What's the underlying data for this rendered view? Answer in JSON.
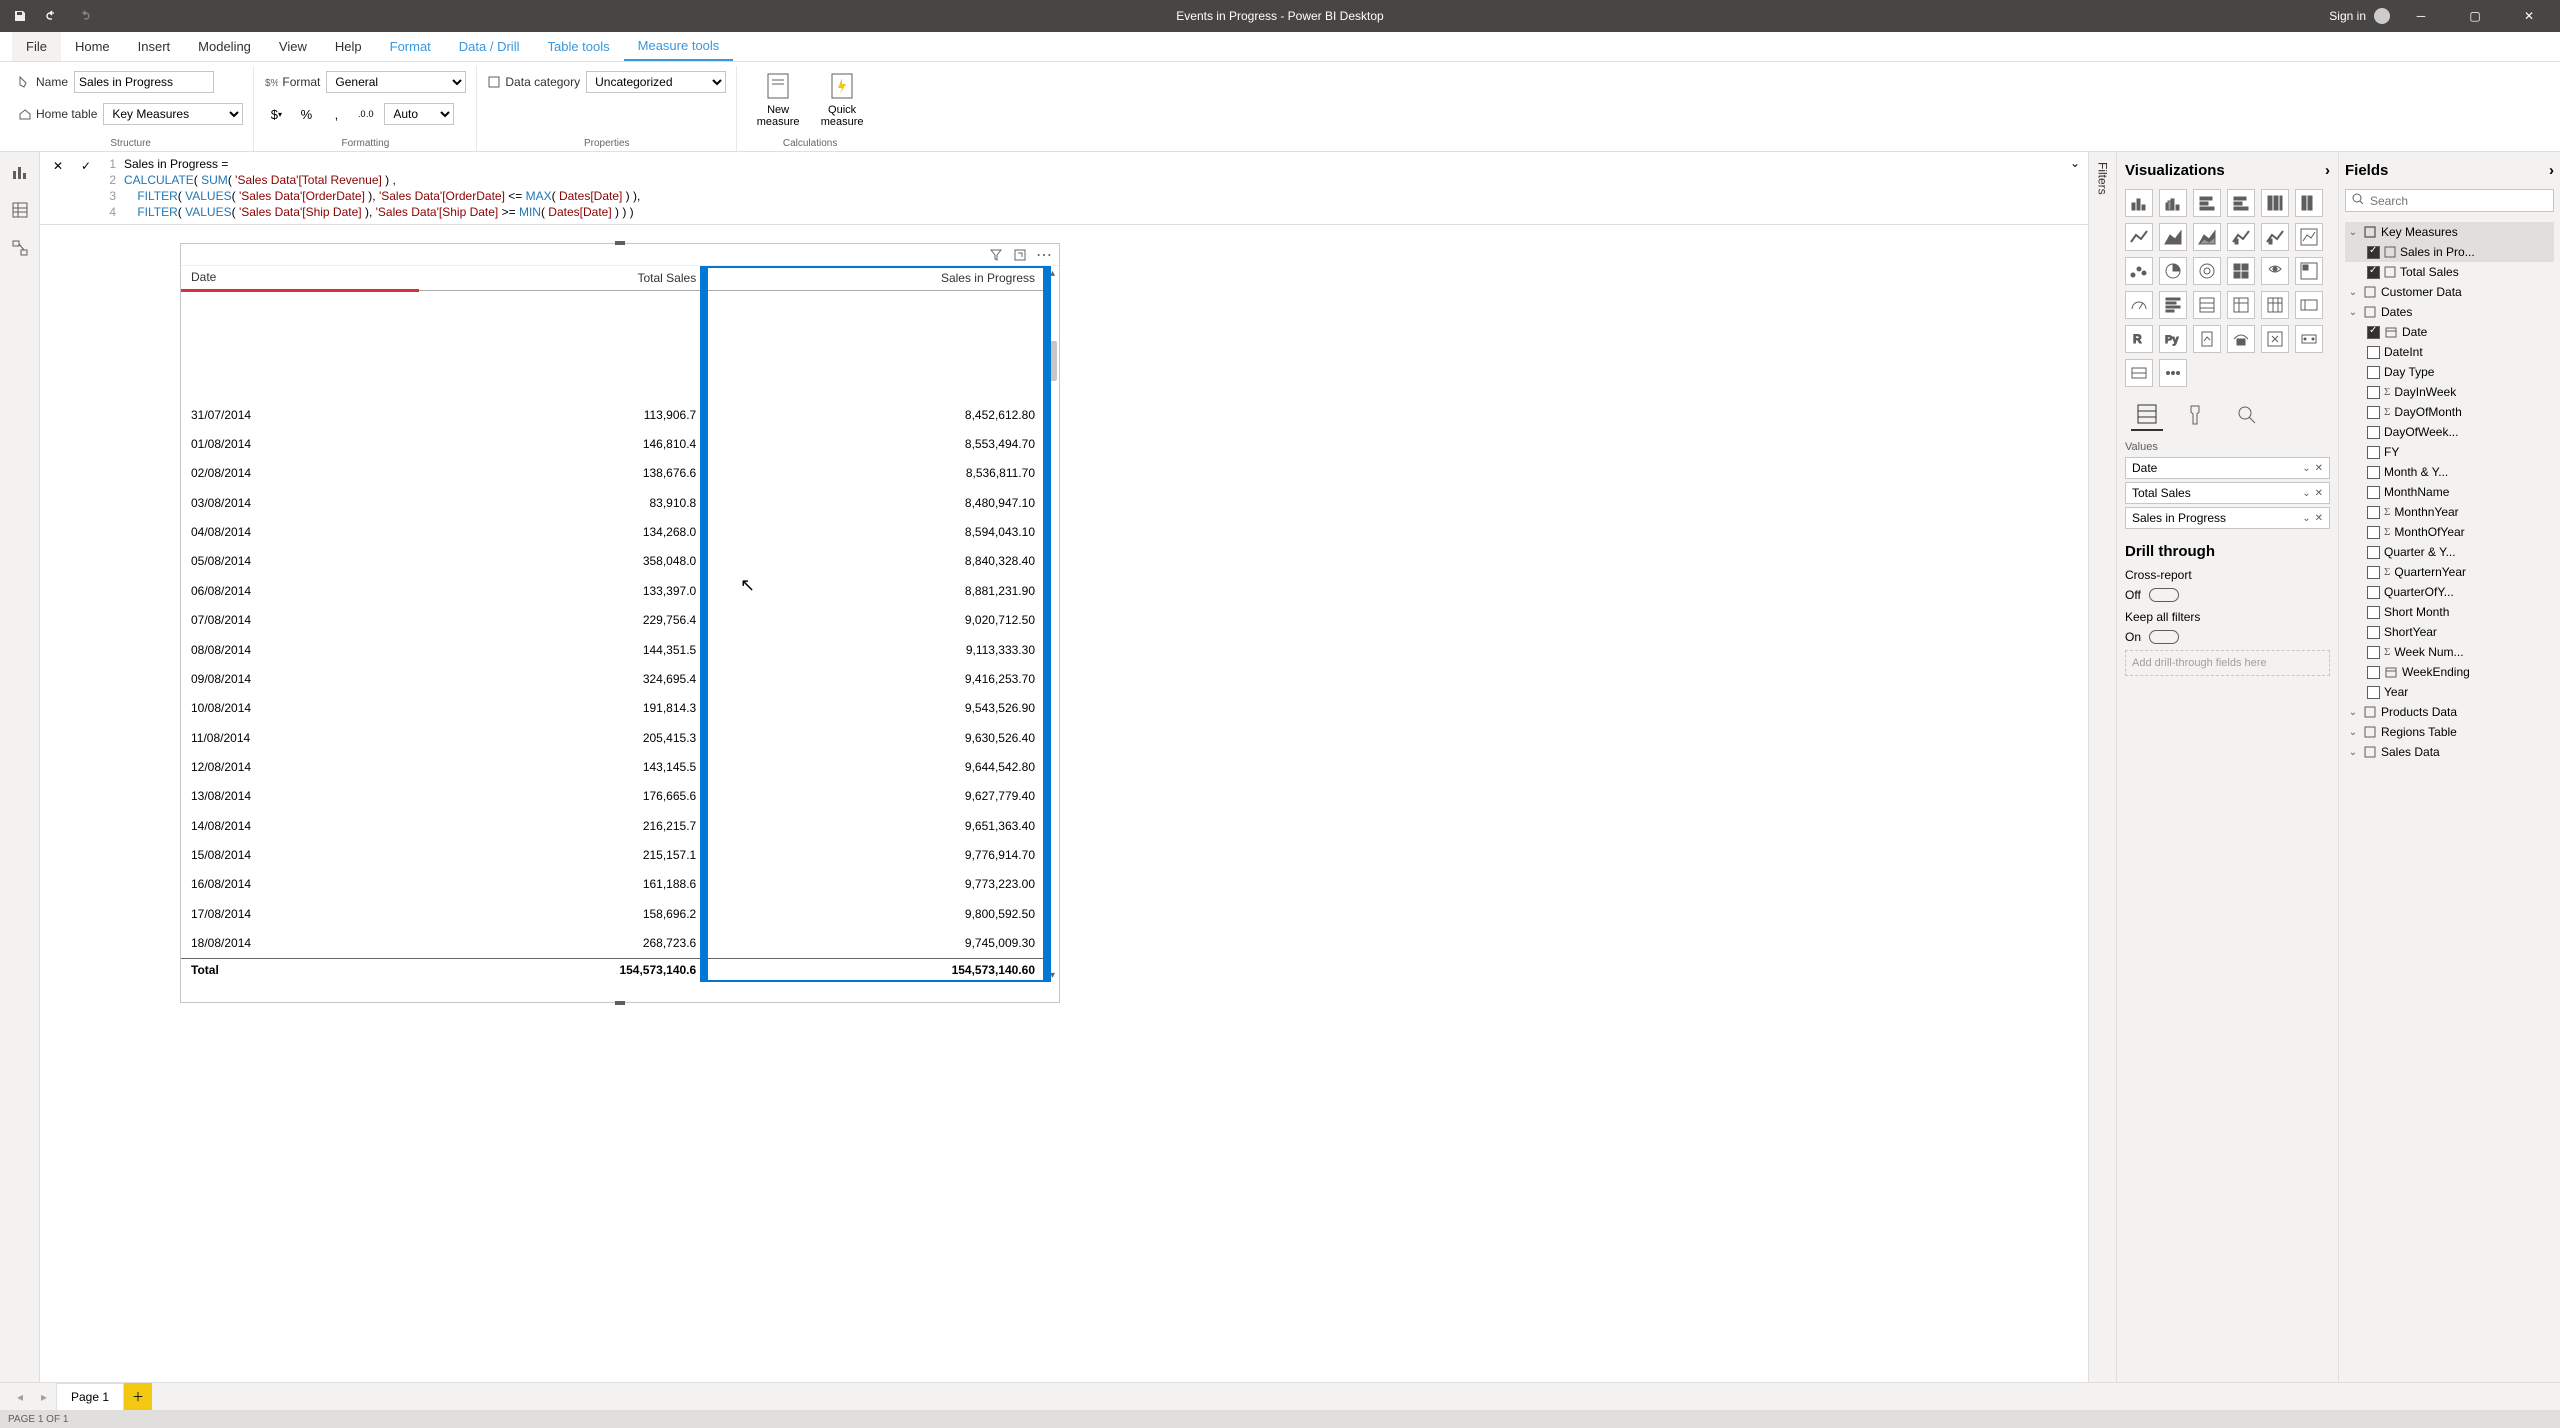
{
  "titlebar": {
    "title": "Events in Progress - Power BI Desktop",
    "signin": "Sign in"
  },
  "ribbon_tabs": {
    "file": "File",
    "tabs": [
      "Home",
      "Insert",
      "Modeling",
      "View",
      "Help",
      "Format",
      "Data / Drill",
      "Table tools",
      "Measure tools"
    ],
    "active": "Measure tools"
  },
  "ribbon": {
    "structure": {
      "name_label": "Name",
      "name_value": "Sales in Progress",
      "home_table_label": "Home table",
      "home_table_value": "Key Measures",
      "group_label": "Structure"
    },
    "formatting": {
      "format_label": "Format",
      "format_value": "General",
      "auto_value": "Auto",
      "group_label": "Formatting"
    },
    "properties": {
      "data_category_label": "Data category",
      "data_category_value": "Uncategorized",
      "group_label": "Properties"
    },
    "calculations": {
      "new_measure": "New measure",
      "quick_measure": "Quick measure",
      "group_label": "Calculations"
    }
  },
  "formula": {
    "lines": [
      {
        "n": "1",
        "text": "Sales in Progress = "
      },
      {
        "n": "2",
        "text": "CALCULATE( SUM( 'Sales Data'[Total Revenue] ) ,"
      },
      {
        "n": "3",
        "text": "    FILTER( VALUES( 'Sales Data'[OrderDate] ), 'Sales Data'[OrderDate] <= MAX( Dates[Date] ) ),"
      },
      {
        "n": "4",
        "text": "    FILTER( VALUES( 'Sales Data'[Ship Date] ), 'Sales Data'[Ship Date] >= MIN( Dates[Date] ) ) )"
      }
    ]
  },
  "table_visual": {
    "columns": [
      "Date",
      "Total Sales",
      "Sales in Progress"
    ],
    "rows": [
      [
        "31/07/2014",
        "113,906.7",
        "8,452,612.80"
      ],
      [
        "01/08/2014",
        "146,810.4",
        "8,553,494.70"
      ],
      [
        "02/08/2014",
        "138,676.6",
        "8,536,811.70"
      ],
      [
        "03/08/2014",
        "83,910.8",
        "8,480,947.10"
      ],
      [
        "04/08/2014",
        "134,268.0",
        "8,594,043.10"
      ],
      [
        "05/08/2014",
        "358,048.0",
        "8,840,328.40"
      ],
      [
        "06/08/2014",
        "133,397.0",
        "8,881,231.90"
      ],
      [
        "07/08/2014",
        "229,756.4",
        "9,020,712.50"
      ],
      [
        "08/08/2014",
        "144,351.5",
        "9,113,333.30"
      ],
      [
        "09/08/2014",
        "324,695.4",
        "9,416,253.70"
      ],
      [
        "10/08/2014",
        "191,814.3",
        "9,543,526.90"
      ],
      [
        "11/08/2014",
        "205,415.3",
        "9,630,526.40"
      ],
      [
        "12/08/2014",
        "143,145.5",
        "9,644,542.80"
      ],
      [
        "13/08/2014",
        "176,665.6",
        "9,627,779.40"
      ],
      [
        "14/08/2014",
        "216,215.7",
        "9,651,363.40"
      ],
      [
        "15/08/2014",
        "215,157.1",
        "9,776,914.70"
      ],
      [
        "16/08/2014",
        "161,188.6",
        "9,773,223.00"
      ],
      [
        "17/08/2014",
        "158,696.2",
        "9,800,592.50"
      ],
      [
        "18/08/2014",
        "268,723.6",
        "9,745,009.30"
      ]
    ],
    "total_label": "Total",
    "totals": [
      "154,573,140.6",
      "154,573,140.60"
    ]
  },
  "filters_label": "Filters",
  "viz_pane": {
    "title": "Visualizations",
    "values_label": "Values",
    "wells": [
      "Date",
      "Total Sales",
      "Sales in Progress"
    ],
    "drill_title": "Drill through",
    "cross_report_label": "Cross-report",
    "off": "Off",
    "keep_filters_label": "Keep all filters",
    "on": "On",
    "dropzone": "Add drill-through fields here"
  },
  "fields_pane": {
    "title": "Fields",
    "search_placeholder": "Search",
    "tables": {
      "key_measures": {
        "label": "Key Measures",
        "items": [
          "Sales in Pro...",
          "Total Sales"
        ]
      },
      "customer_data": "Customer Data",
      "dates": {
        "label": "Dates",
        "items": [
          "Date",
          "DateInt",
          "Day Type",
          "DayInWeek",
          "DayOfMonth",
          "DayOfWeek...",
          "FY",
          "Month & Y...",
          "MonthName",
          "MonthnYear",
          "MonthOfYear",
          "Quarter & Y...",
          "QuarternYear",
          "QuarterOfY...",
          "Short Month",
          "ShortYear",
          "Week Num...",
          "WeekEnding",
          "Year"
        ]
      },
      "products_data": "Products Data",
      "regions_table": "Regions Table",
      "sales_data": "Sales Data"
    }
  },
  "page_tabs": {
    "page1": "Page 1"
  },
  "statusbar": {
    "text": "PAGE 1 OF 1"
  }
}
